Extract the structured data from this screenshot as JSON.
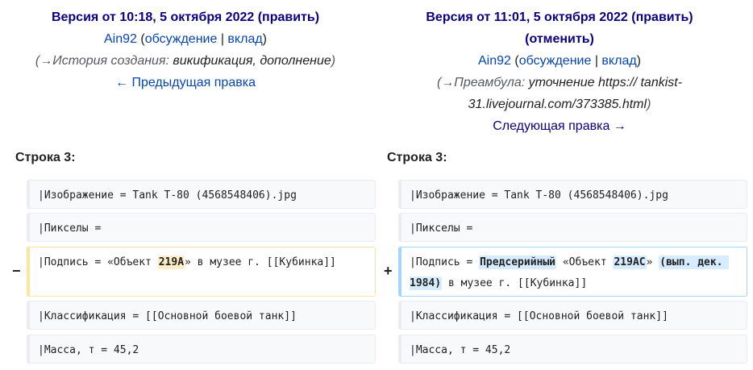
{
  "left_header": {
    "version_label": "Версия от 10:18, 5 октября 2022",
    "edit_label": "(править)",
    "user": "Ain92",
    "paren_open": "(",
    "talk": "обсуждение",
    "sep": "|",
    "contrib": "вклад",
    "paren_close": ")",
    "summary_prefix": "(→История создания:",
    "summary_text": "викификация, дополнение",
    "summary_close": ")",
    "prev_edit": "← Предыдущая правка"
  },
  "right_header": {
    "version_label": "Версия от 11:01, 5 октября 2022",
    "edit_label": "(править)",
    "undo_label": "(отменить)",
    "user": "Ain92",
    "paren_open": "(",
    "talk": "обсуждение",
    "sep": "|",
    "contrib": "вклад",
    "paren_close": ")",
    "summary_prefix": "(→Преамбула:",
    "summary_text": "уточнение https:// tankist-31.livejournal.com/373385.html",
    "summary_close": ")",
    "next_edit": "Следующая правка →"
  },
  "diff": {
    "left_line": "Строка 3:",
    "right_line": "Строка 3:",
    "del_marker": "−",
    "add_marker": "+",
    "rows": {
      "image": "|Изображение = Tank T-80 (4568548406).jpg",
      "pixels": "|Пикселы =",
      "classification": "|Классификация = [[Основной боевой танк]]",
      "mass": "|Масса, т = 45,2"
    },
    "caption_old": {
      "pre": "|Подпись = «Объект ",
      "changed": "219А",
      "post": "» в музее г. [[Кубинка]]"
    },
    "caption_new": {
      "pre": "|Подпись = ",
      "added1": "Предсерийный",
      "mid1": " «Объект ",
      "added2": "219АС",
      "mid2": "» ",
      "added3": "(вып. дек. 1984)",
      "post": " в музее г. [[Кубинка]]"
    }
  }
}
